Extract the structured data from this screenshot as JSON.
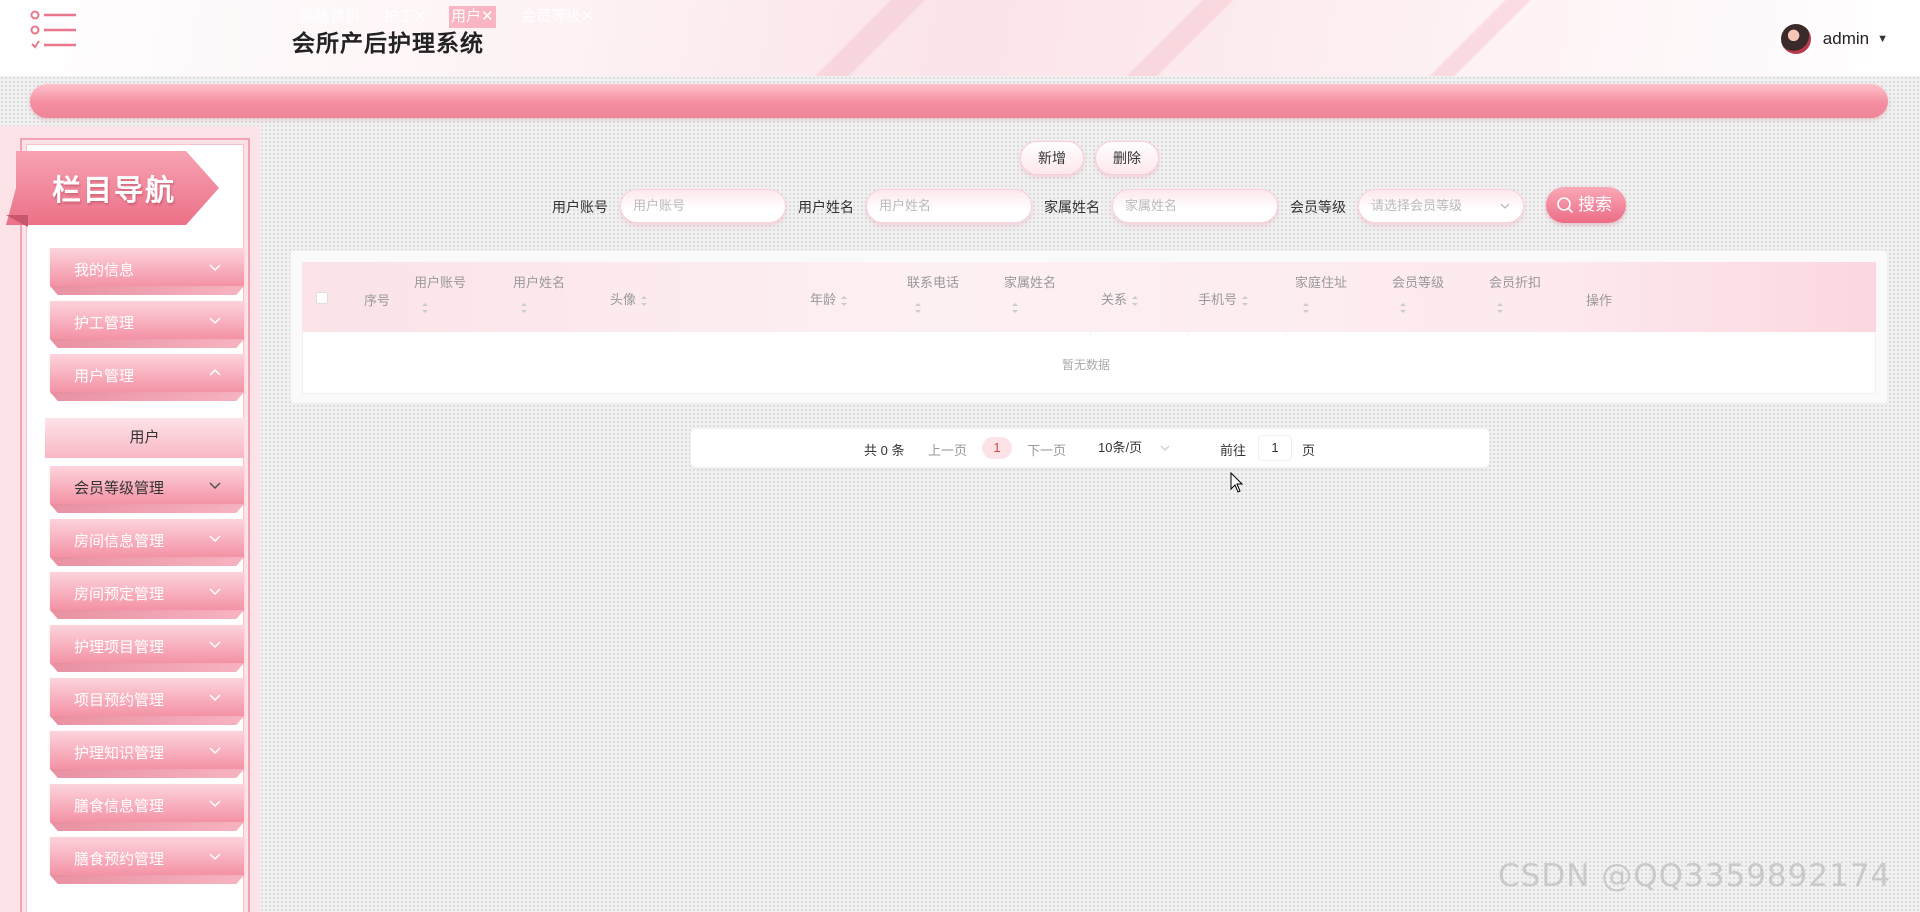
{
  "header": {
    "title": "会所产后护理系统",
    "user": "admin",
    "menu_icon": "menu-list-icon",
    "caret_icon": "caret-down-icon"
  },
  "tabs": [
    {
      "label": "系统首页"
    },
    {
      "label": "护工✕"
    },
    {
      "label": "用户✕"
    },
    {
      "label": "会员等级✕"
    }
  ],
  "sidebar": {
    "title": "栏目导航",
    "items": [
      {
        "label": "我的信息"
      },
      {
        "label": "护工管理"
      },
      {
        "label": "用户管理"
      },
      {
        "label": "会员等级管理"
      },
      {
        "label": "房间信息管理"
      },
      {
        "label": "房间预定管理"
      },
      {
        "label": "护理项目管理"
      },
      {
        "label": "项目预约管理"
      },
      {
        "label": "护理知识管理"
      },
      {
        "label": "膳食信息管理"
      },
      {
        "label": "膳食预约管理"
      }
    ],
    "submenu": {
      "label": "用户"
    }
  },
  "actions": {
    "add": "新增",
    "delete": "删除"
  },
  "search": {
    "account_label": "用户账号",
    "account_placeholder": "用户账号",
    "name_label": "用户姓名",
    "name_placeholder": "用户姓名",
    "family_label": "家属姓名",
    "family_placeholder": "家属姓名",
    "level_label": "会员等级",
    "level_placeholder": "请选择会员等级",
    "button": "搜索"
  },
  "table": {
    "columns": [
      "序号",
      "用户账号",
      "用户姓名",
      "头像",
      "年龄",
      "联系电话",
      "家属姓名",
      "关系",
      "手机号",
      "家庭住址",
      "会员等级",
      "会员折扣",
      "操作"
    ],
    "empty": "暂无数据"
  },
  "pagination": {
    "total": "共 0 条",
    "prev": "上一页",
    "current": "1",
    "next": "下一页",
    "page_size": "10条/页",
    "goto": "前往",
    "goto_value": "1",
    "page_unit": "页"
  },
  "watermark": "CSDN @QQ3359892174",
  "colors": {
    "accent": "#ec6d86",
    "accent_light": "#fbe3e8"
  }
}
